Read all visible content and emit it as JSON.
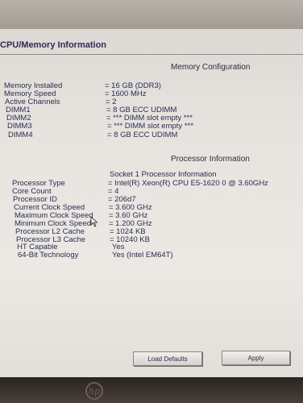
{
  "window": {
    "title": "CPU/Memory Information"
  },
  "memory": {
    "section_title": "Memory Configuration",
    "rows": [
      {
        "label": "Memory Installed",
        "value": "= 16 GB (DDR3)"
      },
      {
        "label": "Memory Speed",
        "value": "= 1600 MHz"
      },
      {
        "label": "Active Channels",
        "value": "= 2"
      },
      {
        "label": "DIMM1",
        "value": "= 8 GB ECC UDIMM"
      },
      {
        "label": "DIMM2",
        "value": "= *** DIMM slot empty ***"
      },
      {
        "label": "DIMM3",
        "value": "= *** DIMM slot empty ***"
      },
      {
        "label": "DIMM4",
        "value": "= 8 GB ECC UDIMM"
      }
    ]
  },
  "processor": {
    "section_title": "Processor Information",
    "socket_heading": "Socket 1 Processor Information",
    "rows": [
      {
        "label": "Processor Type",
        "value": "= Intel(R) Xeon(R) CPU E5-1620 0 @ 3.60GHz"
      },
      {
        "label": "Core Count",
        "value": "= 4"
      },
      {
        "label": "Processor ID",
        "value": "= 206d7"
      },
      {
        "label": "Current Clock Speed",
        "value": "= 3.600 GHz"
      },
      {
        "label": "Maximum Clock Speed",
        "value": "= 3.60 GHz"
      },
      {
        "label": "Minimum Clock Speed",
        "value": "= 1.200 GHz"
      },
      {
        "label": "Processor L2 Cache",
        "value": "= 1024 KB"
      },
      {
        "label": "Processor L3 Cache",
        "value": "= 10240 KB"
      },
      {
        "label": "HT Capable",
        "value": "Yes"
      },
      {
        "label": "64-Bit Technology",
        "value": "Yes (Intel EM64T)"
      }
    ]
  },
  "buttons": {
    "load_defaults": "Load Defaults",
    "apply": "Apply"
  },
  "colors": {
    "text": "#2d2c52",
    "screen": "#e7e4df",
    "bezel": "#3a2f29"
  },
  "icons": {
    "logo": "hp-logo",
    "pointer": "mouse-pointer-icon"
  },
  "bezel_logo_text": "hp"
}
